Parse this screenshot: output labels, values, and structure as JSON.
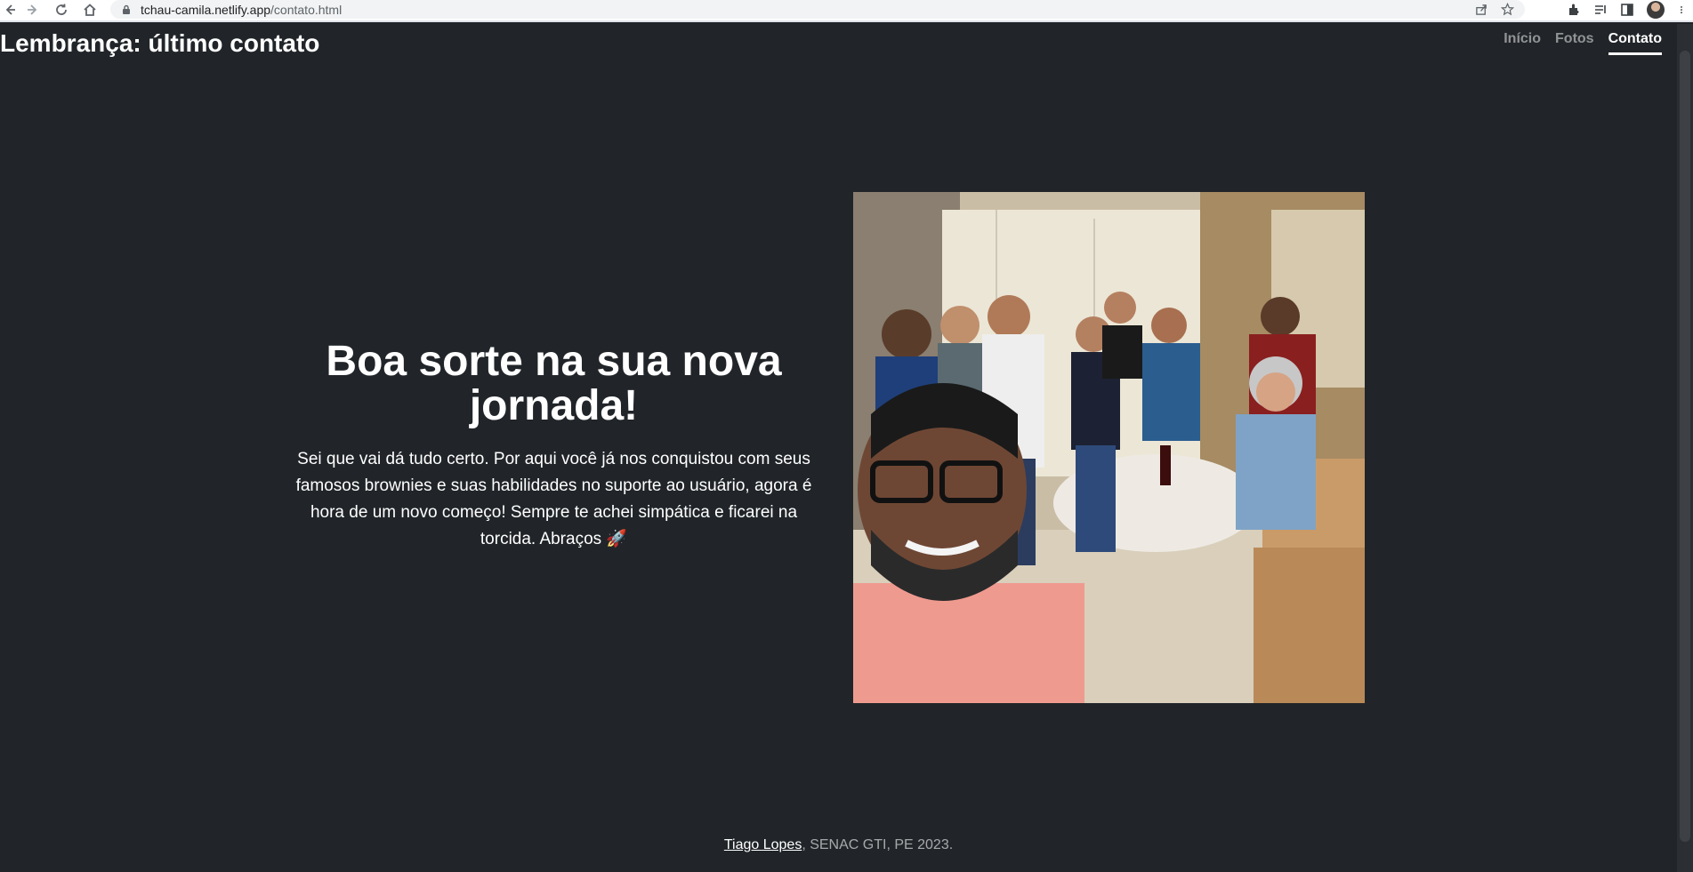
{
  "browser": {
    "url_host": "tchau-camila.netlify.app",
    "url_path": "/contato.html"
  },
  "header": {
    "brand": "Lembrança: último contato",
    "nav": [
      {
        "label": "Início",
        "active": false
      },
      {
        "label": "Fotos",
        "active": false
      },
      {
        "label": "Contato",
        "active": true
      }
    ]
  },
  "main": {
    "heading": "Boa sorte na sua nova jornada!",
    "message": "Sei que vai dá tudo certo. Por aqui você já nos conquistou com seus famosos brownies e suas habilidades no suporte ao usuário, agora é hora de um novo começo! Sempre te achei simpática e ficarei na torcida. Abraços 🚀",
    "photo_description": "Group selfie of coworkers in an office"
  },
  "footer": {
    "author": "Tiago Lopes",
    "rest": ", SENAC GTI, PE 2023."
  },
  "colors": {
    "background": "#212529",
    "text": "#ffffff",
    "nav_inactive": "rgba(255,255,255,0.5)"
  }
}
